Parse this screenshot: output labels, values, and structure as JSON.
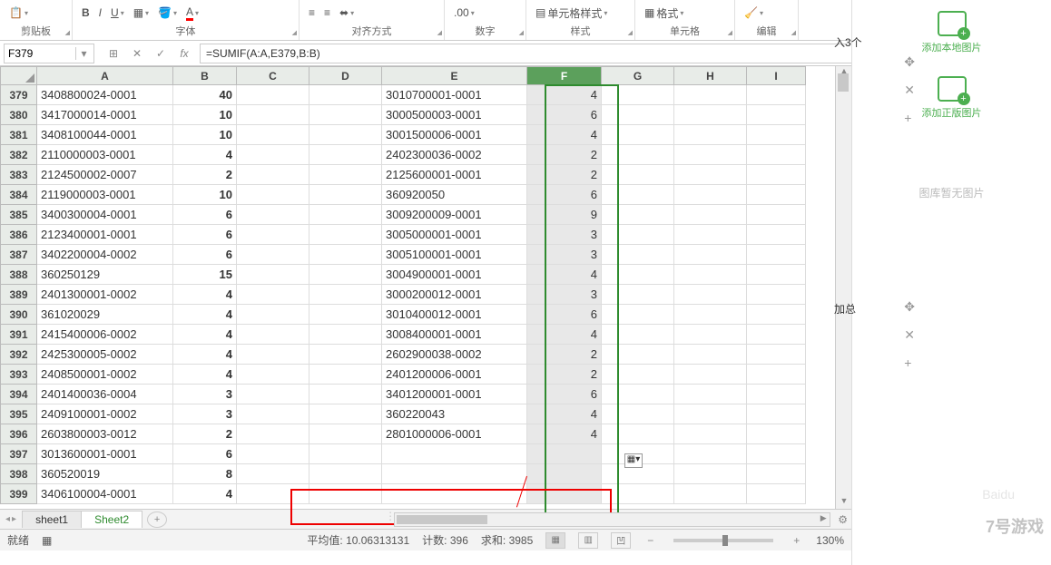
{
  "ribbon": {
    "groups": {
      "clipboard": "剪贴板",
      "font": "字体",
      "alignment": "对齐方式",
      "number": "数字",
      "styles": "样式",
      "cells": "单元格",
      "editing": "编辑"
    },
    "buttons": {
      "cell_styles": "单元格样式",
      "format": "格式"
    }
  },
  "name_box": "F379",
  "formula": "=SUMIF(A:A,E379,B:B)",
  "columns": [
    "A",
    "B",
    "C",
    "D",
    "E",
    "F",
    "G",
    "H",
    "I"
  ],
  "selected_column": "F",
  "rows": [
    {
      "n": 379,
      "a": "3408800024-0001",
      "b": "40",
      "e": "3010700001-0001",
      "f": "4"
    },
    {
      "n": 380,
      "a": "3417000014-0001",
      "b": "10",
      "e": "3000500003-0001",
      "f": "6"
    },
    {
      "n": 381,
      "a": "3408100044-0001",
      "b": "10",
      "e": "3001500006-0001",
      "f": "4"
    },
    {
      "n": 382,
      "a": "2110000003-0001",
      "b": "4",
      "e": "2402300036-0002",
      "f": "2"
    },
    {
      "n": 383,
      "a": "2124500002-0007",
      "b": "2",
      "e": "2125600001-0001",
      "f": "2"
    },
    {
      "n": 384,
      "a": "2119000003-0001",
      "b": "10",
      "e": "360920050",
      "f": "6"
    },
    {
      "n": 385,
      "a": "3400300004-0001",
      "b": "6",
      "e": "3009200009-0001",
      "f": "9"
    },
    {
      "n": 386,
      "a": "2123400001-0001",
      "b": "6",
      "e": "3005000001-0001",
      "f": "3"
    },
    {
      "n": 387,
      "a": "3402200004-0002",
      "b": "6",
      "e": "3005100001-0001",
      "f": "3"
    },
    {
      "n": 388,
      "a": "360250129",
      "b": "15",
      "e": "3004900001-0001",
      "f": "4"
    },
    {
      "n": 389,
      "a": "2401300001-0002",
      "b": "4",
      "e": "3000200012-0001",
      "f": "3"
    },
    {
      "n": 390,
      "a": "361020029",
      "b": "4",
      "e": "3010400012-0001",
      "f": "6"
    },
    {
      "n": 391,
      "a": "2415400006-0002",
      "b": "4",
      "e": "3008400001-0001",
      "f": "4"
    },
    {
      "n": 392,
      "a": "2425300005-0002",
      "b": "4",
      "e": "2602900038-0002",
      "f": "2"
    },
    {
      "n": 393,
      "a": "2408500001-0002",
      "b": "4",
      "e": "2401200006-0001",
      "f": "2"
    },
    {
      "n": 394,
      "a": "2401400036-0004",
      "b": "3",
      "e": "3401200001-0001",
      "f": "6"
    },
    {
      "n": 395,
      "a": "2409100001-0002",
      "b": "3",
      "e": "360220043",
      "f": "4"
    },
    {
      "n": 396,
      "a": "2603800003-0012",
      "b": "2",
      "e": "2801000006-0001",
      "f": "4"
    },
    {
      "n": 397,
      "a": "3013600001-0001",
      "b": "6",
      "e": "",
      "f": ""
    },
    {
      "n": 398,
      "a": "360520019",
      "b": "8",
      "e": "",
      "f": ""
    },
    {
      "n": 399,
      "a": "3406100004-0001",
      "b": "4",
      "e": "",
      "f": ""
    }
  ],
  "tabs": {
    "sheet1": "sheet1",
    "sheet2": "Sheet2"
  },
  "status": {
    "ready": "就绪",
    "avg_label": "平均值:",
    "avg_value": "10.06313131",
    "count_label": "计数:",
    "count_value": "396",
    "sum_label": "求和:",
    "sum_value": "3985",
    "zoom": "130%"
  },
  "side": {
    "local_img": "添加本地图片",
    "stock_img": "添加正版图片",
    "no_img": "图库暂无图片",
    "badge1": "入3个",
    "badge2": "加总"
  },
  "watermark": {
    "main": "7号游戏",
    "sub": "Baidu"
  }
}
